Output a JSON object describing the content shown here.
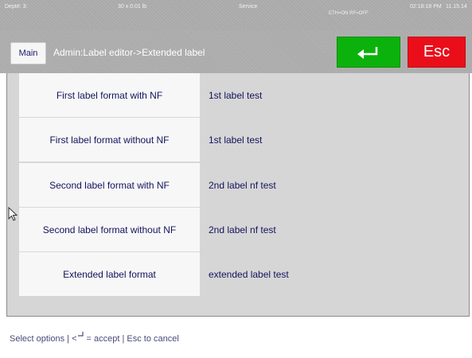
{
  "status": {
    "dept": "Dept#: 3:",
    "weight": "30 x 0.01 lb",
    "mode": "Service",
    "time": "02:18:18 PM",
    "date": "11.15.14",
    "network": "ETH=ON RF=OFF"
  },
  "header": {
    "main_label": "Main",
    "breadcrumb": "Admin:Label editor->Extended label",
    "esc_label": "Esc",
    "enter_icon": "enter-return-icon",
    "enter_color": "#0cb20c",
    "esc_color": "#ea0e1a"
  },
  "rows": [
    {
      "option": "First label format with NF",
      "value": "1st label test"
    },
    {
      "option": "First label format without NF",
      "value": "1st label test"
    },
    {
      "option": "Second label format with NF",
      "value": "2nd label nf test"
    },
    {
      "option": "Second label format without NF",
      "value": "2nd label nf test"
    },
    {
      "option": "Extended label format",
      "value": "extended label test"
    }
  ],
  "footer": {
    "hint_prefix": "Select options | <",
    "hint_suffix": " = accept | Esc to cancel"
  }
}
